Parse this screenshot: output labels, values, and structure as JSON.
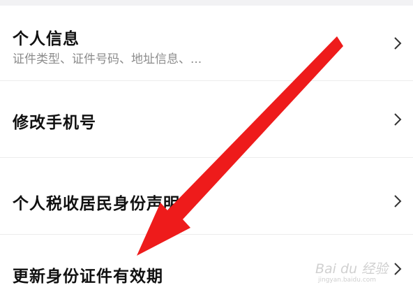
{
  "menu": {
    "items": [
      {
        "title": "个人信息",
        "subtitle": "证件类型、证件号码、地址信息、..."
      },
      {
        "title": "修改手机号"
      },
      {
        "title": "个人税收居民身份声明"
      },
      {
        "title": "更新身份证件有效期"
      }
    ]
  },
  "watermark": {
    "text": "Bai du 经验",
    "subtext": "jingyan.baidu.com"
  },
  "colors": {
    "arrow": "#ee1b1b",
    "title": "#111111",
    "subtitle": "#8c8c8c",
    "divider": "#ececec"
  },
  "icons": {
    "chevron": "chevron-right-icon",
    "arrow": "red-arrow-annotation"
  }
}
